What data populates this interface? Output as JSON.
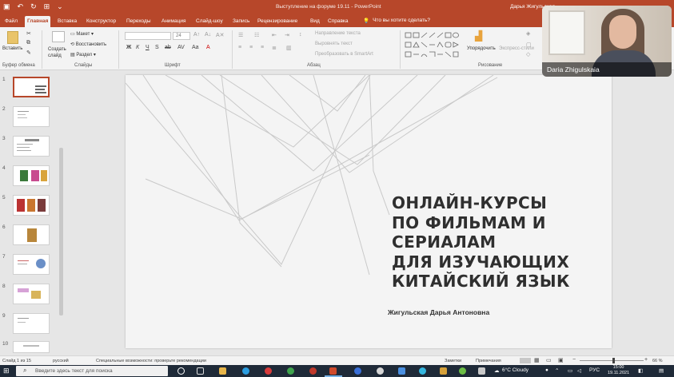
{
  "window": {
    "title": "Выступление на форуме 19.11 - PowerPoint",
    "user": "Дарья Жигульская"
  },
  "tabs": [
    "Файл",
    "Главная",
    "Вставка",
    "Конструктор",
    "Переходы",
    "Анимация",
    "Слайд-шоу",
    "Запись",
    "Рецензирование",
    "Вид",
    "Справка"
  ],
  "tell_me": "Что вы хотите сделать?",
  "ribbon": {
    "paste": "Вставить",
    "clipboard_group": "Буфер обмена",
    "new_slide": "Создать слайд",
    "layout": "Макет",
    "reset": "Восстановить",
    "section": "Раздел",
    "slides_group": "Слайды",
    "font_group": "Шрифт",
    "font_size": "24",
    "text_direction": "Направление текста",
    "align_text": "Выровнять текст",
    "smartart": "Преобразовать в SmartArt",
    "paragraph_group": "Абзац",
    "arrange": "Упорядочить",
    "quick_styles": "Экспресс-стили",
    "drawing_group": "Рисование"
  },
  "thumbnails": [
    {
      "number": "1",
      "selected": true
    },
    {
      "number": "2",
      "selected": false
    },
    {
      "number": "3",
      "selected": false
    },
    {
      "number": "4",
      "selected": false
    },
    {
      "number": "5",
      "selected": false
    },
    {
      "number": "6",
      "selected": false
    },
    {
      "number": "7",
      "selected": false
    },
    {
      "number": "8",
      "selected": false
    },
    {
      "number": "9",
      "selected": false
    },
    {
      "number": "10",
      "selected": false
    }
  ],
  "slide": {
    "title_lines": [
      "ОНЛАЙН-КУРСЫ",
      "ПО ФИЛЬМАМ И",
      "СЕРИАЛАМ",
      "ДЛЯ ИЗУЧАЮЩИХ",
      "КИТАЙСКИЙ ЯЗЫК"
    ],
    "author": "Жигульская Дарья Антоновна"
  },
  "webcam": {
    "participant": "Daria Zhigulskaia"
  },
  "status": {
    "slide_info": "Слайд 1 из 15",
    "language": "русский",
    "accessibility": "Специальные возможности: проверьте рекомендации",
    "notes": "Заметки",
    "comments": "Примечания",
    "zoom": "66 %"
  },
  "taskbar": {
    "search_placeholder": "Введите здесь текст для поиска",
    "weather": "6°C  Cloudy",
    "language": "РУС",
    "time": "15:00",
    "date": "19.11.2021"
  },
  "colors": {
    "accent": "#b7472a",
    "slide_bg": "#f4f4f4",
    "taskbar": "#1f2a38"
  }
}
